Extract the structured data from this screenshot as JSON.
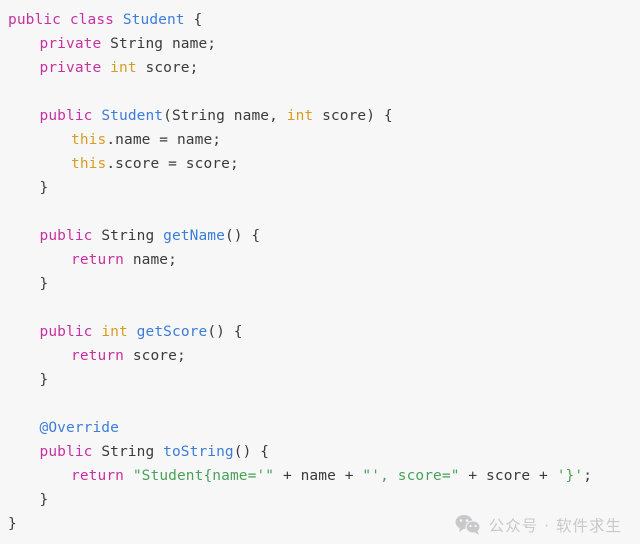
{
  "document": {
    "kind": "code-screenshot",
    "language": "Java",
    "background_color": "#f7f7f8"
  },
  "theme": {
    "keyword_color": "#c832a0",
    "type_color": "#3b7dd8",
    "primitive_color": "#d79c20",
    "this_color": "#d79c20",
    "plain_color": "#3b3b3b",
    "string_color": "#49a259",
    "annotation_color": "#3b7dd8",
    "watermark_color": "#c9c9cb"
  },
  "code": {
    "lines": [
      {
        "indent": 0,
        "tokens": [
          {
            "t": "public",
            "c": "kw"
          },
          {
            "t": " ",
            "c": "plain"
          },
          {
            "t": "class",
            "c": "kw"
          },
          {
            "t": " ",
            "c": "plain"
          },
          {
            "t": "Student",
            "c": "type"
          },
          {
            "t": " {",
            "c": "plain"
          }
        ]
      },
      {
        "indent": 1,
        "tokens": [
          {
            "t": "private",
            "c": "kw"
          },
          {
            "t": " String name;",
            "c": "plain"
          }
        ]
      },
      {
        "indent": 1,
        "tokens": [
          {
            "t": "private",
            "c": "kw"
          },
          {
            "t": " ",
            "c": "plain"
          },
          {
            "t": "int",
            "c": "prim"
          },
          {
            "t": " score;",
            "c": "plain"
          }
        ]
      },
      {
        "indent": 0,
        "tokens": []
      },
      {
        "indent": 1,
        "tokens": [
          {
            "t": "public",
            "c": "kw"
          },
          {
            "t": " ",
            "c": "plain"
          },
          {
            "t": "Student",
            "c": "type"
          },
          {
            "t": "(String name, ",
            "c": "plain"
          },
          {
            "t": "int",
            "c": "prim"
          },
          {
            "t": " score) {",
            "c": "plain"
          }
        ]
      },
      {
        "indent": 2,
        "tokens": [
          {
            "t": "this",
            "c": "this"
          },
          {
            "t": ".name = name;",
            "c": "plain"
          }
        ]
      },
      {
        "indent": 2,
        "tokens": [
          {
            "t": "this",
            "c": "this"
          },
          {
            "t": ".score = score;",
            "c": "plain"
          }
        ]
      },
      {
        "indent": 1,
        "tokens": [
          {
            "t": "}",
            "c": "plain"
          }
        ]
      },
      {
        "indent": 0,
        "tokens": []
      },
      {
        "indent": 1,
        "tokens": [
          {
            "t": "public",
            "c": "kw"
          },
          {
            "t": " String ",
            "c": "plain"
          },
          {
            "t": "getName",
            "c": "type"
          },
          {
            "t": "() {",
            "c": "plain"
          }
        ]
      },
      {
        "indent": 2,
        "tokens": [
          {
            "t": "return",
            "c": "kw"
          },
          {
            "t": " name;",
            "c": "plain"
          }
        ]
      },
      {
        "indent": 1,
        "tokens": [
          {
            "t": "}",
            "c": "plain"
          }
        ]
      },
      {
        "indent": 0,
        "tokens": []
      },
      {
        "indent": 1,
        "tokens": [
          {
            "t": "public",
            "c": "kw"
          },
          {
            "t": " ",
            "c": "plain"
          },
          {
            "t": "int",
            "c": "prim"
          },
          {
            "t": " ",
            "c": "plain"
          },
          {
            "t": "getScore",
            "c": "type"
          },
          {
            "t": "() {",
            "c": "plain"
          }
        ]
      },
      {
        "indent": 2,
        "tokens": [
          {
            "t": "return",
            "c": "kw"
          },
          {
            "t": " score;",
            "c": "plain"
          }
        ]
      },
      {
        "indent": 1,
        "tokens": [
          {
            "t": "}",
            "c": "plain"
          }
        ]
      },
      {
        "indent": 0,
        "tokens": []
      },
      {
        "indent": 1,
        "tokens": [
          {
            "t": "@Override",
            "c": "anno"
          }
        ]
      },
      {
        "indent": 1,
        "tokens": [
          {
            "t": "public",
            "c": "kw"
          },
          {
            "t": " String ",
            "c": "plain"
          },
          {
            "t": "toString",
            "c": "type"
          },
          {
            "t": "() {",
            "c": "plain"
          }
        ]
      },
      {
        "indent": 2,
        "tokens": [
          {
            "t": "return",
            "c": "kw"
          },
          {
            "t": " ",
            "c": "plain"
          },
          {
            "t": "\"Student{name='\"",
            "c": "str"
          },
          {
            "t": " + name + ",
            "c": "plain"
          },
          {
            "t": "\"', score=\"",
            "c": "str"
          },
          {
            "t": " + score + ",
            "c": "plain"
          },
          {
            "t": "'}'",
            "c": "str"
          },
          {
            "t": ";",
            "c": "plain"
          }
        ]
      },
      {
        "indent": 1,
        "tokens": [
          {
            "t": "}",
            "c": "plain"
          }
        ]
      },
      {
        "indent": 0,
        "tokens": [
          {
            "t": "}",
            "c": "plain"
          }
        ]
      }
    ],
    "plain_text": "public class Student {\n    private String name;\n    private int score;\n\n    public Student(String name, int score) {\n        this.name = name;\n        this.score = score;\n    }\n\n    public String getName() {\n        return name;\n    }\n\n    public int getScore() {\n        return score;\n    }\n\n    @Override\n    public String toString() {\n        return \"Student{name='\" + name + \"', score=\" + score + '}';\n    }\n}"
  },
  "watermark": {
    "icon": "wechat-icon",
    "text": "公众号 · 软件求生"
  }
}
